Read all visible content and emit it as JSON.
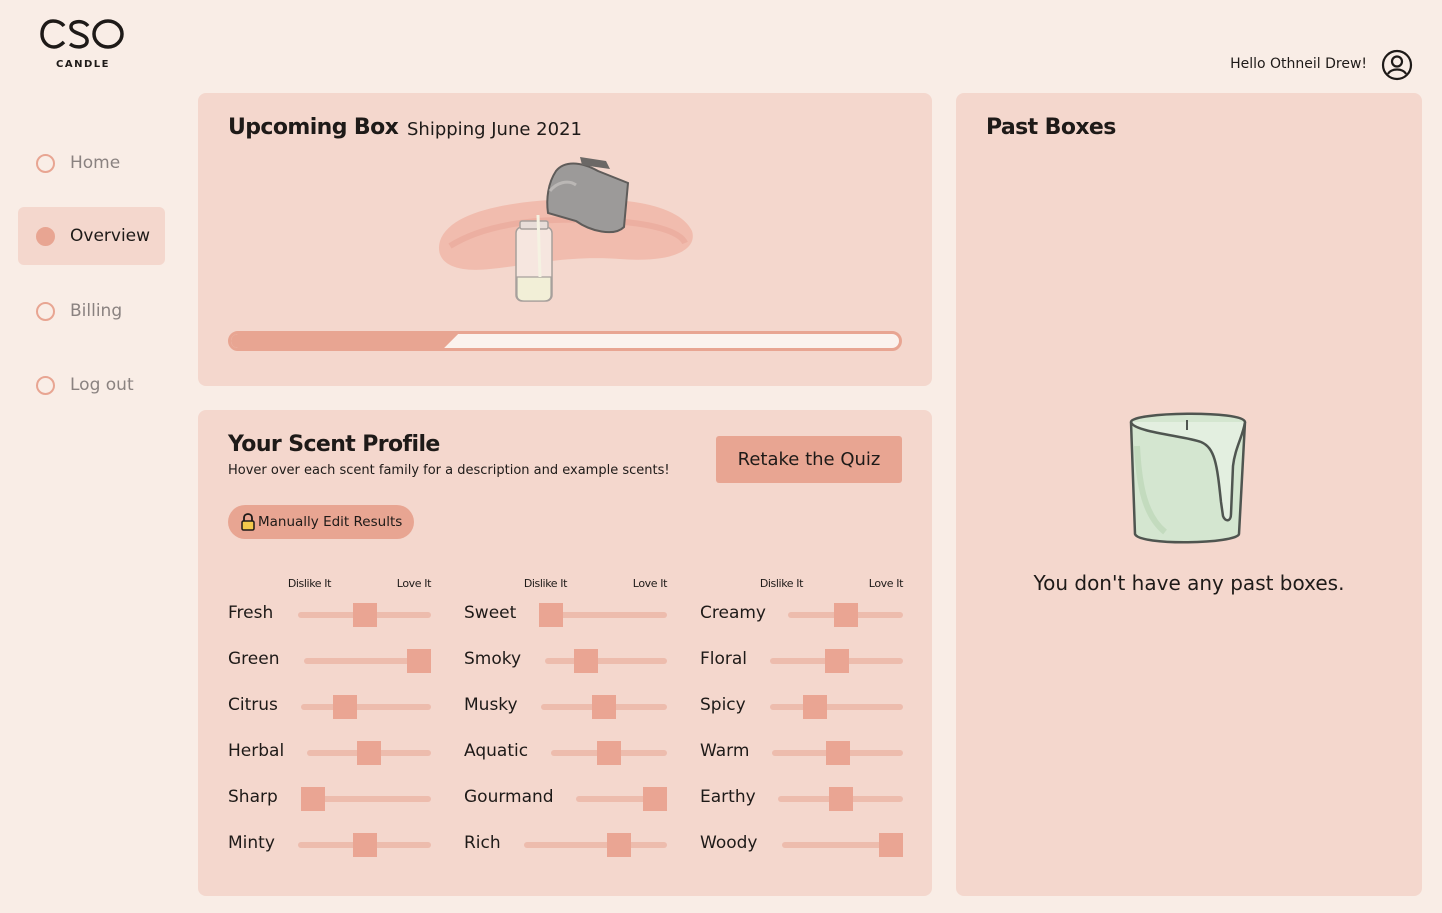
{
  "brand": {
    "logo_text": "CSO",
    "logo_sub": "CANDLE"
  },
  "header": {
    "greeting": "Hello Othneil Drew!"
  },
  "nav": {
    "items": [
      {
        "label": "Home",
        "active": false
      },
      {
        "label": "Overview",
        "active": true
      },
      {
        "label": "Billing",
        "active": false
      },
      {
        "label": "Log out",
        "active": false
      }
    ]
  },
  "upcoming": {
    "title": "Upcoming Box",
    "shipping": "Shipping June 2021",
    "progress": 0.34
  },
  "profile": {
    "title": "Your Scent Profile",
    "subtitle": "Hover over each scent family for a description and example scents!",
    "retake_label": "Retake the Quiz",
    "manual_edit_label": "Manually Edit Results",
    "axis": {
      "dislike": "Dislike It",
      "love": "Love It"
    },
    "columns": [
      [
        {
          "name": "Fresh",
          "value": 0.5
        },
        {
          "name": "Green",
          "value": 1.0
        },
        {
          "name": "Citrus",
          "value": 0.3
        },
        {
          "name": "Herbal",
          "value": 0.5
        },
        {
          "name": "Sharp",
          "value": 0.0
        },
        {
          "name": "Minty",
          "value": 0.5
        }
      ],
      [
        {
          "name": "Sweet",
          "value": 0.0
        },
        {
          "name": "Smoky",
          "value": 0.3
        },
        {
          "name": "Musky",
          "value": 0.5
        },
        {
          "name": "Aquatic",
          "value": 0.5
        },
        {
          "name": "Gourmand",
          "value": 1.0
        },
        {
          "name": "Rich",
          "value": 0.7
        }
      ],
      [
        {
          "name": "Creamy",
          "value": 0.5
        },
        {
          "name": "Floral",
          "value": 0.5
        },
        {
          "name": "Spicy",
          "value": 0.3
        },
        {
          "name": "Warm",
          "value": 0.5
        },
        {
          "name": "Earthy",
          "value": 0.5
        },
        {
          "name": "Woody",
          "value": 1.0
        }
      ]
    ]
  },
  "past": {
    "title": "Past Boxes",
    "empty_text": "You don't have any past boxes."
  },
  "colors": {
    "accent": "#e8a592",
    "card": "#f4d7cd",
    "background": "#f9ede6",
    "candle": "#d4e6d0"
  },
  "icons": {
    "profile": "user-circle-icon",
    "lock": "lock-icon"
  }
}
